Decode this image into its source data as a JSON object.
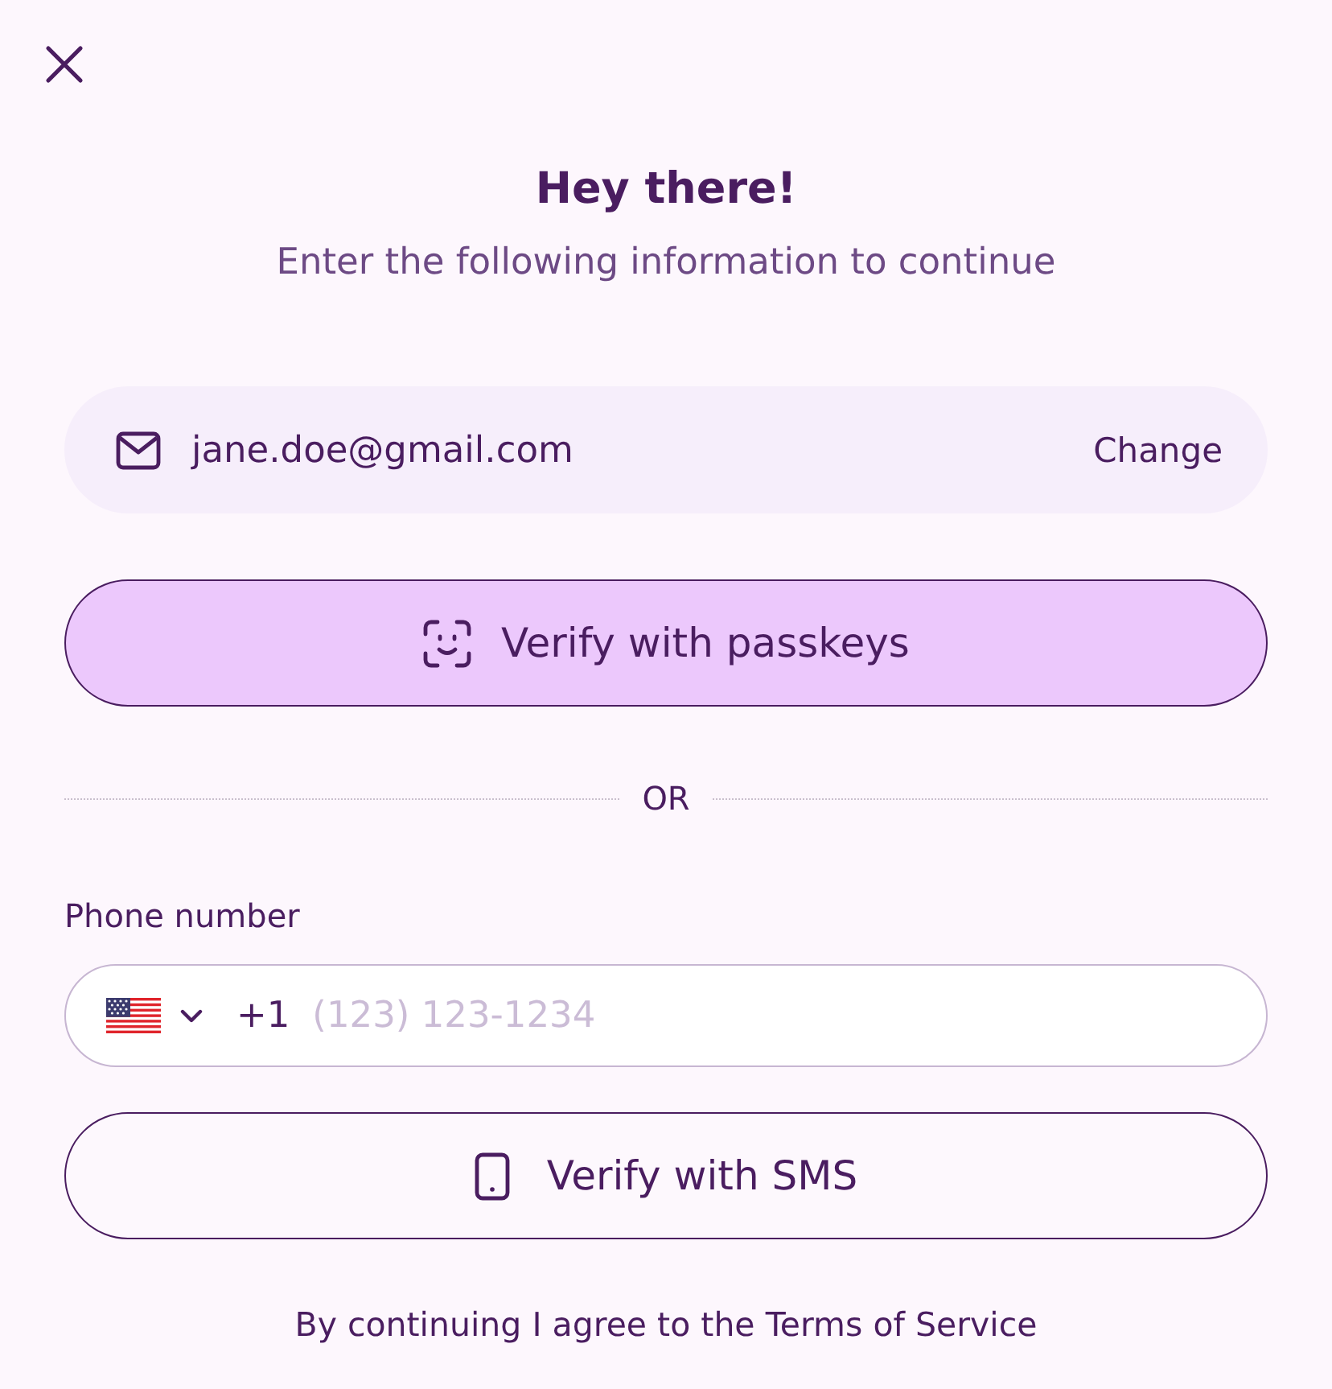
{
  "header": {
    "title": "Hey there!",
    "subtitle": "Enter the following information to continue"
  },
  "email": {
    "value": "jane.doe@gmail.com",
    "action": "Change"
  },
  "passkey_button": {
    "label": "Verify with passkeys"
  },
  "divider": {
    "label": "OR"
  },
  "phone": {
    "label": "Phone number",
    "country_code": "+1",
    "placeholder": "(123) 123-1234"
  },
  "sms_button": {
    "label": "Verify with SMS"
  },
  "footer": {
    "text": "By continuing I agree to the Terms of Service"
  }
}
